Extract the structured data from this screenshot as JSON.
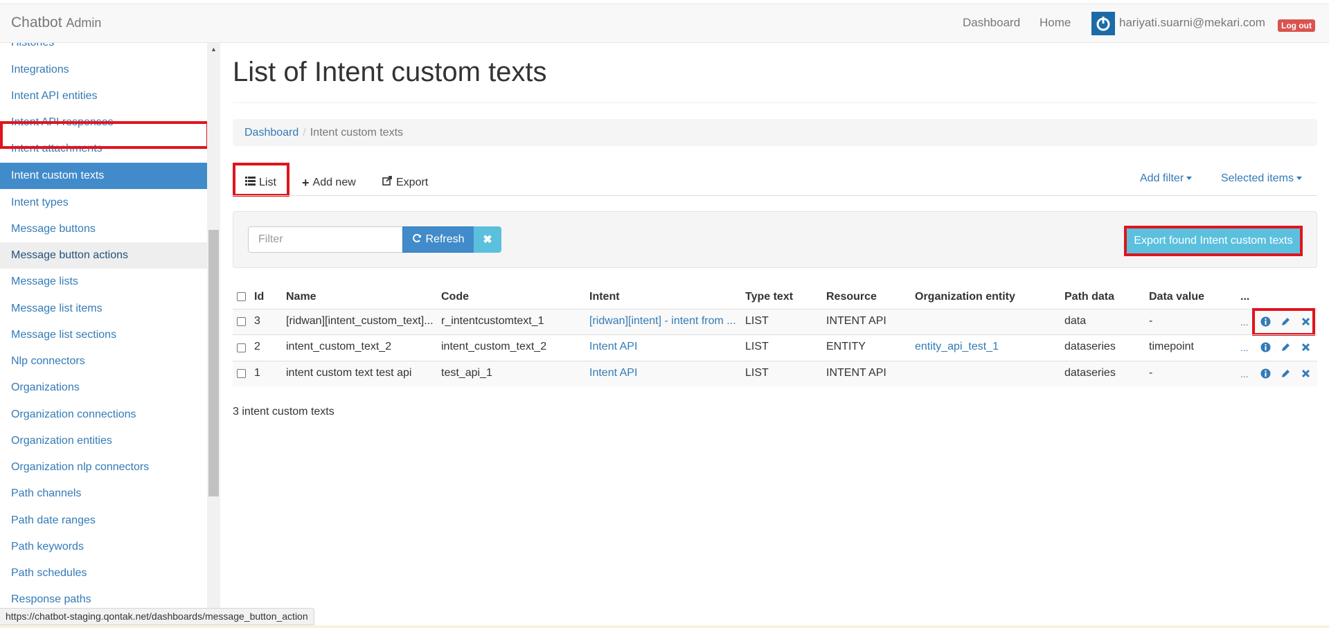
{
  "navbar": {
    "brand": "Chatbot",
    "brand_sub": "Admin",
    "links": [
      "Dashboard",
      "Home"
    ],
    "user_email": "hariyati.suarni@mekari.com",
    "logout": "Log out"
  },
  "sidebar": {
    "items": [
      {
        "label": "Histories"
      },
      {
        "label": "Integrations"
      },
      {
        "label": "Intent API entities"
      },
      {
        "label": "Intent API responses"
      },
      {
        "label": "Intent attachments"
      },
      {
        "label": "Intent custom texts",
        "active": true
      },
      {
        "label": "Intent types"
      },
      {
        "label": "Message buttons"
      },
      {
        "label": "Message button actions",
        "hover": true
      },
      {
        "label": "Message lists"
      },
      {
        "label": "Message list items"
      },
      {
        "label": "Message list sections"
      },
      {
        "label": "Nlp connectors"
      },
      {
        "label": "Organizations"
      },
      {
        "label": "Organization connections"
      },
      {
        "label": "Organization entities"
      },
      {
        "label": "Organization nlp connectors"
      },
      {
        "label": "Path channels"
      },
      {
        "label": "Path date ranges"
      },
      {
        "label": "Path keywords"
      },
      {
        "label": "Path schedules"
      },
      {
        "label": "Response paths"
      }
    ]
  },
  "page": {
    "title": "List of Intent custom texts",
    "breadcrumb": {
      "root": "Dashboard",
      "separator": "/",
      "current": "Intent custom texts"
    }
  },
  "tabs": {
    "list": "List",
    "add_new": "Add new",
    "export": "Export",
    "add_filter": "Add filter",
    "selected_items": "Selected items"
  },
  "filter": {
    "placeholder": "Filter",
    "refresh": "Refresh",
    "export_found": "Export found Intent custom texts"
  },
  "table": {
    "headers": [
      "Id",
      "Name",
      "Code",
      "Intent",
      "Type text",
      "Resource",
      "Organization entity",
      "Path data",
      "Data value",
      "..."
    ],
    "rows": [
      {
        "id": "3",
        "name": "[ridwan][intent_custom_text]...",
        "code": "r_intentcustomtext_1",
        "intent": "[ridwan][intent] - intent from ...",
        "type_text": "LIST",
        "resource": "INTENT API",
        "org_entity": "",
        "path_data": "data",
        "data_value": "-",
        "more": "..."
      },
      {
        "id": "2",
        "name": "intent_custom_text_2",
        "code": "intent_custom_text_2",
        "intent": "Intent API",
        "type_text": "LIST",
        "resource": "ENTITY",
        "org_entity": "entity_api_test_1",
        "path_data": "dataseries",
        "data_value": "timepoint",
        "more": "..."
      },
      {
        "id": "1",
        "name": "intent custom text test api",
        "code": "test_api_1",
        "intent": "Intent API",
        "type_text": "LIST",
        "resource": "INTENT API",
        "org_entity": "",
        "path_data": "dataseries",
        "data_value": "-",
        "more": "..."
      }
    ]
  },
  "footer": {
    "count": "3 intent custom texts"
  },
  "status_bar": {
    "url": "https://chatbot-staging.qontak.net/dashboards/message_button_action"
  }
}
